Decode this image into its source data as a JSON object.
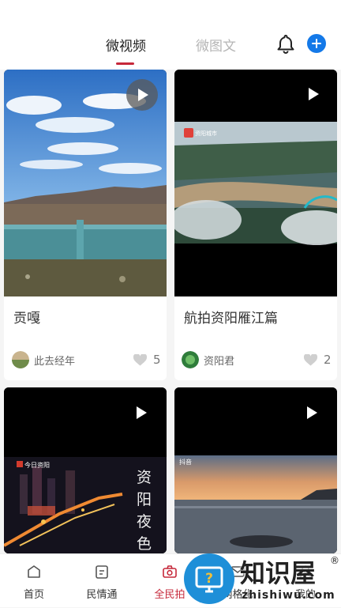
{
  "header": {
    "tabs": [
      {
        "label": "微视频",
        "active": true
      },
      {
        "label": "微图文",
        "active": false
      }
    ],
    "icons": [
      "bell-icon",
      "add-icon"
    ]
  },
  "cards": [
    {
      "title": "贡嘎",
      "author": "此去经年",
      "likes": "5"
    },
    {
      "title": "航拍资阳雁江篇",
      "author": "资阳君",
      "likes": "2",
      "video_brand": "资阳城市"
    },
    {
      "overlay_source": "今日资阳",
      "overlay_title": "资阳夜色"
    },
    {
      "overlay_source": "抖音"
    }
  ],
  "bottom_nav": {
    "items": [
      {
        "label": "首页",
        "icon": "home-icon"
      },
      {
        "label": "民情通",
        "icon": "clipboard-icon"
      },
      {
        "label": "全民拍",
        "icon": "camera-icon",
        "active": true
      },
      {
        "label": "网格化",
        "icon": "mail-icon"
      },
      {
        "label": "我的",
        "icon": "user-icon"
      }
    ]
  },
  "watermark": {
    "text": "知识屋",
    "url": "zhishiwu.com",
    "reg": "®"
  },
  "colors": {
    "accent": "#c6283a",
    "brand_blue": "#1479e8",
    "inactive": "#b5b5b5"
  }
}
